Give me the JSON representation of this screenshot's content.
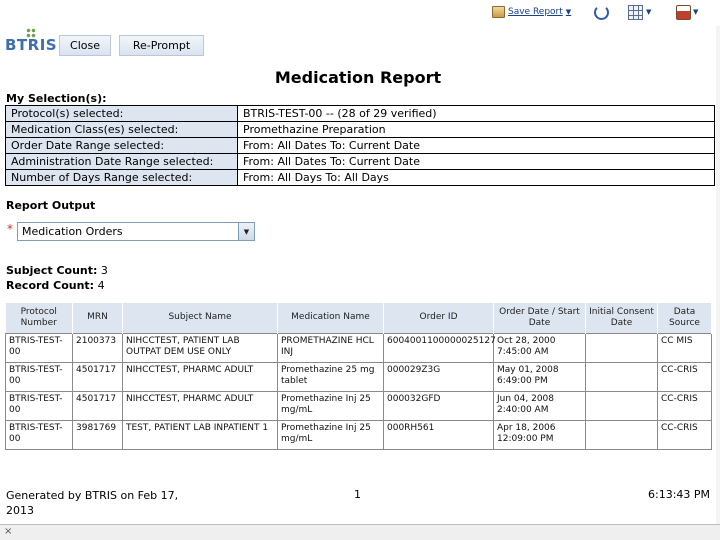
{
  "toolbar": {
    "save_report_label": "Save Report",
    "caret": "▼"
  },
  "logo": {
    "text": "BTRIS"
  },
  "buttons": {
    "close": "Close",
    "reprompt": "Re-Prompt"
  },
  "report": {
    "title": "Medication Report"
  },
  "selections": {
    "heading": "My Selection(s):",
    "rows": [
      {
        "label": "Protocol(s) selected:",
        "value": "BTRIS-TEST-00 -- (28 of 29 verified)"
      },
      {
        "label": "Medication Class(es) selected:",
        "value": "Promethazine Preparation"
      },
      {
        "label": "Order Date Range selected:",
        "value": "From:   All Dates To:   Current Date"
      },
      {
        "label": "Administration Date Range selected:",
        "value": "From:   All Dates To:   Current Date"
      },
      {
        "label": "Number of Days Range selected:",
        "value": "From:   All Days To:   All Days"
      }
    ]
  },
  "output": {
    "heading": "Report Output",
    "required_marker": "*",
    "selected": "Medication Orders"
  },
  "counts": {
    "subject_label": "Subject Count:",
    "subject_value": "3",
    "record_label": "Record Count:",
    "record_value": "4"
  },
  "table": {
    "headers": [
      "Protocol Number",
      "MRN",
      "Subject Name",
      "Medication Name",
      "Order ID",
      "Order Date / Start Date",
      "Initial Consent Date",
      "Data Source"
    ],
    "rows": [
      [
        "BTRIS-TEST-00",
        "2100373",
        "NIHCCTEST, PATIENT LAB OUTPAT DEM USE ONLY",
        "PROMETHAZINE HCL INJ",
        "6004001100000025127",
        "Oct 28, 2000 7:45:00 AM",
        "",
        "CC MIS"
      ],
      [
        "BTRIS-TEST-00",
        "4501717",
        "NIHCCTEST, PHARMC ADULT",
        "Promethazine 25 mg tablet",
        "000029Z3G",
        "May 01, 2008 6:49:00 PM",
        "",
        "CC-CRIS"
      ],
      [
        "BTRIS-TEST-00",
        "4501717",
        "NIHCCTEST, PHARMC ADULT",
        "Promethazine Inj 25 mg/mL",
        "000032GFD",
        "Jun 04, 2008 2:40:00 AM",
        "",
        "CC-CRIS"
      ],
      [
        "BTRIS-TEST-00",
        "3981769",
        "TEST, PATIENT LAB INPATIENT 1",
        "Promethazine Inj 25 mg/mL",
        "000RH561",
        "Apr 18, 2006 12:09:00 PM",
        "",
        "CC-CRIS"
      ]
    ]
  },
  "footer": {
    "generated": "Generated by BTRIS on Feb 17, 2013",
    "page": "1",
    "time": "6:13:43 PM"
  },
  "status": {
    "close_glyph": "×"
  }
}
